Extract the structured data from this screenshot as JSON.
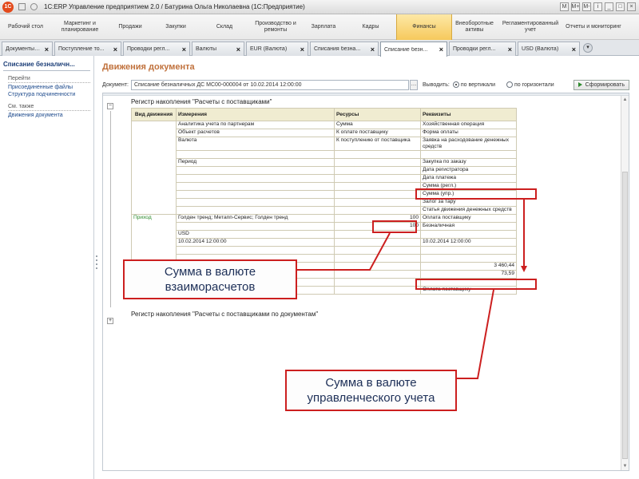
{
  "window": {
    "title": "1С:ERP Управление предприятием 2.0 / Батурина Ольга Николаевна  (1С:Предприятие)",
    "controls": [
      "M",
      "M+",
      "M-",
      "i",
      "_",
      "□",
      "×"
    ]
  },
  "sections": [
    {
      "label": "Рабочий стол",
      "width": 64
    },
    {
      "label": "Маркетинг и планирование",
      "width": 72
    },
    {
      "label": "Продажи",
      "width": 54
    },
    {
      "label": "Закупки",
      "width": 60
    },
    {
      "label": "Склад",
      "width": 62
    },
    {
      "label": "Производство и ремонты",
      "width": 66
    },
    {
      "label": "Зарплата",
      "width": 54
    },
    {
      "label": "Кадры",
      "width": 64
    },
    {
      "label": "Финансы",
      "width": 70,
      "active": true
    },
    {
      "label": "Внеоборотные активы",
      "width": 56
    },
    {
      "label": "Регламентированный учет",
      "width": 84
    },
    {
      "label": "Отчеты и мониторинг",
      "width": 74
    }
  ],
  "tabs": [
    {
      "label": "Документы по...",
      "width": 64
    },
    {
      "label": "Поступление то...",
      "width": 84
    },
    {
      "label": "Проводки регл...",
      "width": 84
    },
    {
      "label": "Валюты",
      "width": 66
    },
    {
      "label": "EUR (Валюта)",
      "width": 78
    },
    {
      "label": "Списания безна...",
      "width": 86
    },
    {
      "label": "Списание безн...",
      "width": 84,
      "active": true
    },
    {
      "label": "Проводки регл...",
      "width": 84
    },
    {
      "label": "USD (Валюта)",
      "width": 78
    }
  ],
  "leftpanel": {
    "title": "Списание безналичн...",
    "goto_head": "Перейти",
    "goto_links": [
      "Присоединенные файлы",
      "Структура подчиненности"
    ],
    "seealso_head": "См. также",
    "seealso_links": [
      "Движения документа"
    ]
  },
  "main": {
    "title": "Движения документа",
    "doc_label": "Документ:",
    "doc_value": "Списание безналичных ДС МС00-000004 от 10.02.2014 12:00:00",
    "output_label": "Выводить:",
    "opt_vertical": "по вертикали",
    "opt_horizontal": "по горизонтали",
    "generate_label": "Сформировать"
  },
  "report": {
    "reg1_title": "Регистр накопления \"Расчеты с поставщиками\"",
    "reg2_title": "Регистр накопления \"Расчеты с поставщиками по документам\"",
    "headers": [
      "Вид движения",
      "Измерения",
      "Ресурсы",
      "Реквизиты"
    ],
    "dims": [
      "Аналитика учета по партнерам",
      "Объект расчетов",
      "Валюта",
      "Период"
    ],
    "res": [
      "Сумма",
      "К оплате поставщику",
      "К поступлению от поставщика"
    ],
    "reqs": [
      "Хозяйственная операция",
      "Форма оплаты",
      "Заявка на расходование денежных средств",
      "Закупка по заказу",
      "Дата регистратора",
      "Дата платежа",
      "Сумма (регл.)",
      "Сумма (упр.)",
      "Залог за тару",
      "Статья движения денежных средств"
    ],
    "move_type": "Приход",
    "dim_values": [
      "Голден тренд; Метапп-Сервис; Голден тренд",
      "",
      "USD",
      "10.02.2014 12:00:00"
    ],
    "res_values": [
      "100",
      "100"
    ],
    "req_values": [
      "Оплата поставщику",
      "Безналичная",
      "",
      "10.02.2014 12:00:00",
      "",
      "3 460,44",
      "73,59",
      "",
      "Оплата поставщику"
    ]
  },
  "annotations": {
    "callout1": [
      "Сумма в валюте",
      "взаиморасчетов"
    ],
    "callout2": [
      "Сумма в валюте",
      "управленческого учета"
    ]
  }
}
